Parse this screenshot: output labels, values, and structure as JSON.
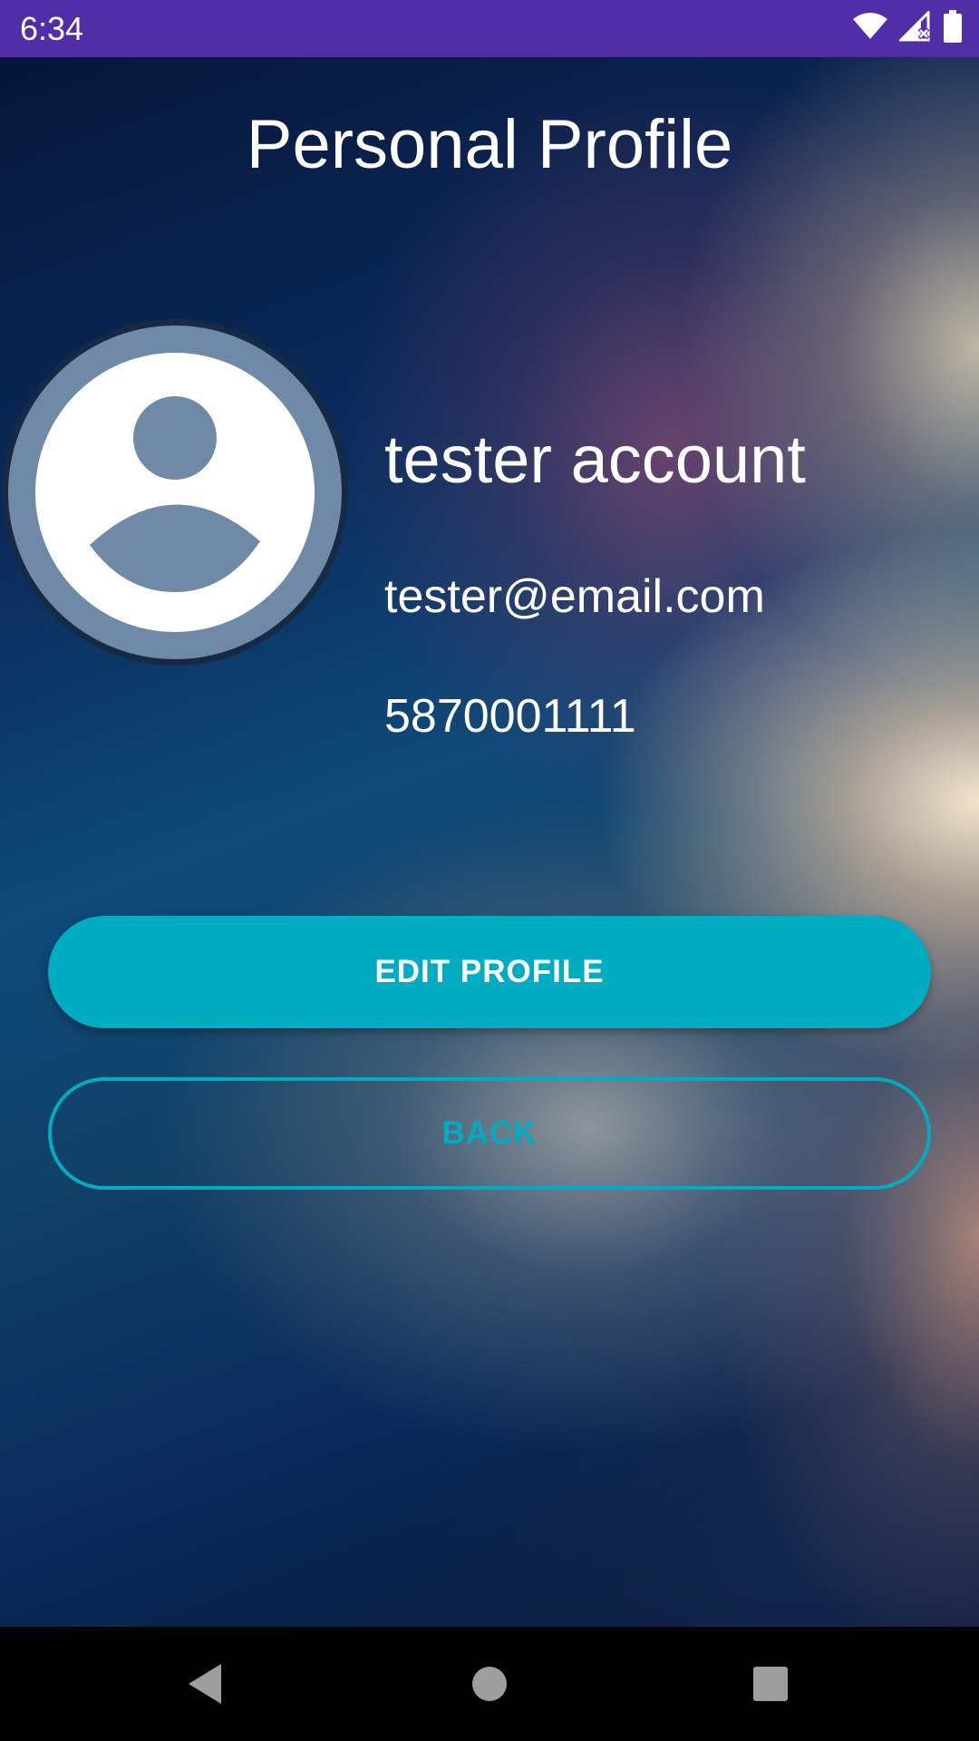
{
  "status_bar": {
    "time": "6:34",
    "icons": [
      "wifi-icon",
      "cell-signal-icon",
      "battery-icon"
    ]
  },
  "page": {
    "title": "Personal Profile"
  },
  "profile": {
    "name": "tester account",
    "email": "tester@email.com",
    "phone": "5870001111"
  },
  "buttons": {
    "edit_profile": "EDIT PROFILE",
    "back": "BACK"
  },
  "nav_bar": {
    "icons": [
      "back-triangle-icon",
      "home-circle-icon",
      "recents-square-icon"
    ]
  },
  "colors": {
    "status_bar": "#512da8",
    "accent": "#00acc1",
    "avatar_fill": "#7089a6",
    "nav_bar": "#000000"
  }
}
